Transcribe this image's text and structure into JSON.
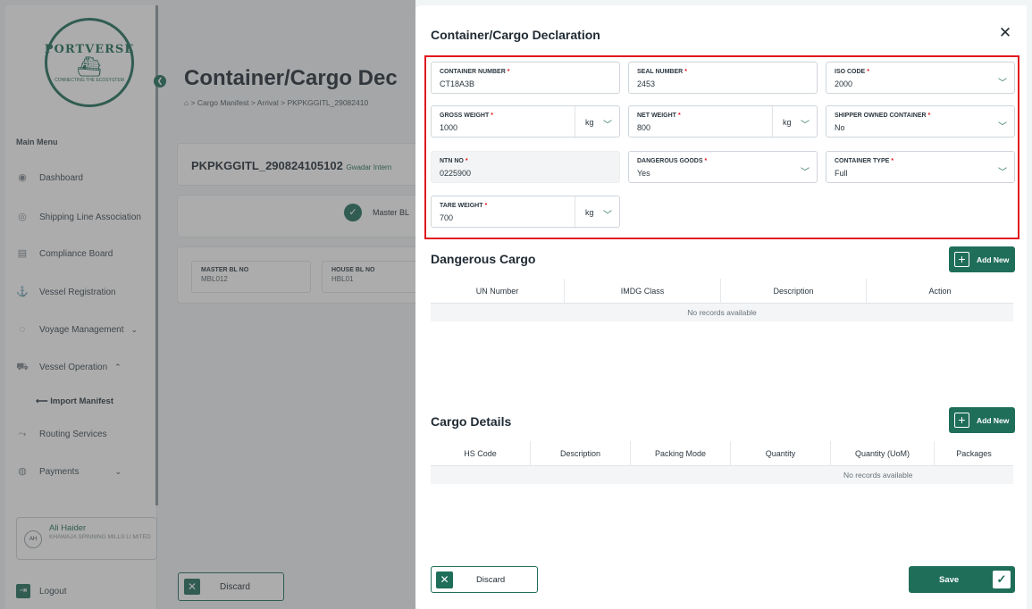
{
  "background": {
    "brand": {
      "top": "PORTVERSE",
      "bottom": "CONNECTING THE ECOSYSTEM"
    },
    "main_menu_label": "Main Menu",
    "sidebar": [
      {
        "label": "Dashboard",
        "icon": "dashboard-icon"
      },
      {
        "label": "Shipping Line Association",
        "icon": "association-icon"
      },
      {
        "label": "Compliance Board",
        "icon": "document-icon"
      },
      {
        "label": "Vessel Registration",
        "icon": "vessel-icon"
      },
      {
        "label": "Voyage Management",
        "icon": "voyage-icon"
      },
      {
        "label": "Vessel Operation",
        "icon": "operation-icon"
      },
      {
        "label": "Routing Services",
        "icon": "routing-icon"
      },
      {
        "label": "Payments",
        "icon": "payments-icon"
      }
    ],
    "sub_item": "Import Manifest",
    "user": {
      "initials": "AH",
      "name": "Ali Haider",
      "org": "KHAWAJA SPINNING MILLS LI MITED"
    },
    "logout": "Logout",
    "page_title": "Container/Cargo Dec",
    "breadcrumb": "> Cargo Manifest > Arrival > PKPKGGITL_29082410",
    "bl_title": "PKPKGGITL_290824105102",
    "bl_port": "Gwadar Intern",
    "master_step": "Master BL",
    "master_bl": {
      "label": "MASTER BL NO",
      "value": "MBL012"
    },
    "house_bl": {
      "label": "HOUSE BL NO",
      "value": "HBL01"
    },
    "discard": "Discard"
  },
  "modal": {
    "title": "Container/Cargo Declaration",
    "fields": {
      "container_number": {
        "label": "CONTAINER NUMBER",
        "value": "CT18A3B"
      },
      "seal_number": {
        "label": "SEAL NUMBER",
        "value": "2453"
      },
      "iso_code": {
        "label": "ISO CODE",
        "value": "2000"
      },
      "gross_weight": {
        "label": "GROSS WEIGHT",
        "value": "1000",
        "unit": "kg"
      },
      "net_weight": {
        "label": "NET WEIGHT",
        "value": "800",
        "unit": "kg"
      },
      "shipper_owned": {
        "label": "SHIPPER OWNED CONTAINER",
        "value": "No"
      },
      "ntn_no": {
        "label": "NTN NO",
        "value": "0225900"
      },
      "dangerous_goods": {
        "label": "DANGEROUS GOODS",
        "value": "Yes"
      },
      "container_type": {
        "label": "CONTAINER TYPE",
        "value": "Full"
      },
      "tare_weight": {
        "label": "TARE WEIGHT",
        "value": "700",
        "unit": "kg"
      }
    },
    "dangerous_cargo": {
      "title": "Dangerous Cargo",
      "add_label": "Add New",
      "columns": [
        "UN Number",
        "IMDG Class",
        "Description",
        "Action"
      ],
      "empty": "No records available"
    },
    "cargo_details": {
      "title": "Cargo Details",
      "add_label": "Add New",
      "columns": [
        "HS Code",
        "Description",
        "Packing Mode",
        "Quantity",
        "Quantity (UoM)",
        "Packages"
      ],
      "empty": "No records available"
    },
    "discard_label": "Discard",
    "save_label": "Save"
  },
  "colors": {
    "brand": "#1f6e5a",
    "highlight": "#e0191e",
    "required": "#e0191e"
  }
}
